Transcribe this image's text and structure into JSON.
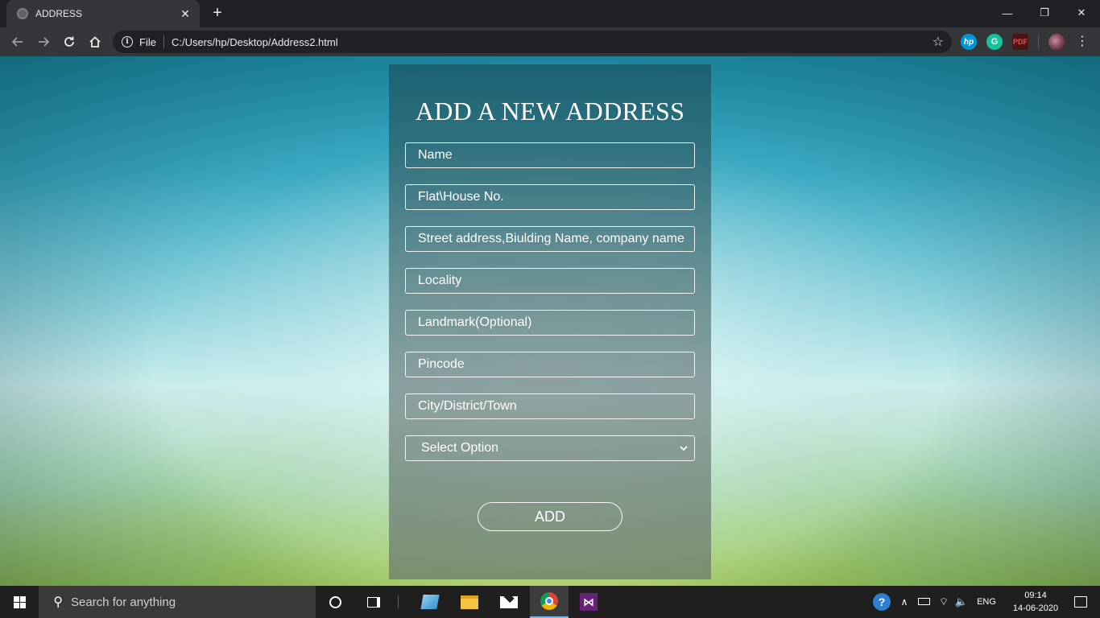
{
  "browser": {
    "tab_title": "ADDRESS",
    "tab_close": "✕",
    "new_tab": "+",
    "file_label": "File",
    "url": "C:/Users/hp/Desktop/Address2.html",
    "window_controls": {
      "minimize": "—",
      "restore": "❐",
      "close": "✕"
    },
    "extensions": {
      "hp": "hp",
      "grammarly": "G",
      "pdf": "PDF"
    }
  },
  "form": {
    "title": "ADD A NEW ADDRESS",
    "fields": [
      {
        "placeholder": "Name"
      },
      {
        "placeholder": "Flat\\House No."
      },
      {
        "placeholder": "Street address,Biulding Name, company name"
      },
      {
        "placeholder": "Locality"
      },
      {
        "placeholder": "Landmark(Optional)"
      },
      {
        "placeholder": "Pincode"
      },
      {
        "placeholder": "City/District/Town"
      }
    ],
    "select": {
      "selected": "Select Option"
    },
    "submit_label": "ADD"
  },
  "taskbar": {
    "search_placeholder": "Search for anything",
    "language": "ENG",
    "time": "09:14",
    "date": "14-06-2020"
  },
  "colors": {
    "browser_frame": "#202124",
    "toolbar": "#35363a",
    "taskbar": "#1f1f1f",
    "active_app_underline": "#76b9ed"
  }
}
